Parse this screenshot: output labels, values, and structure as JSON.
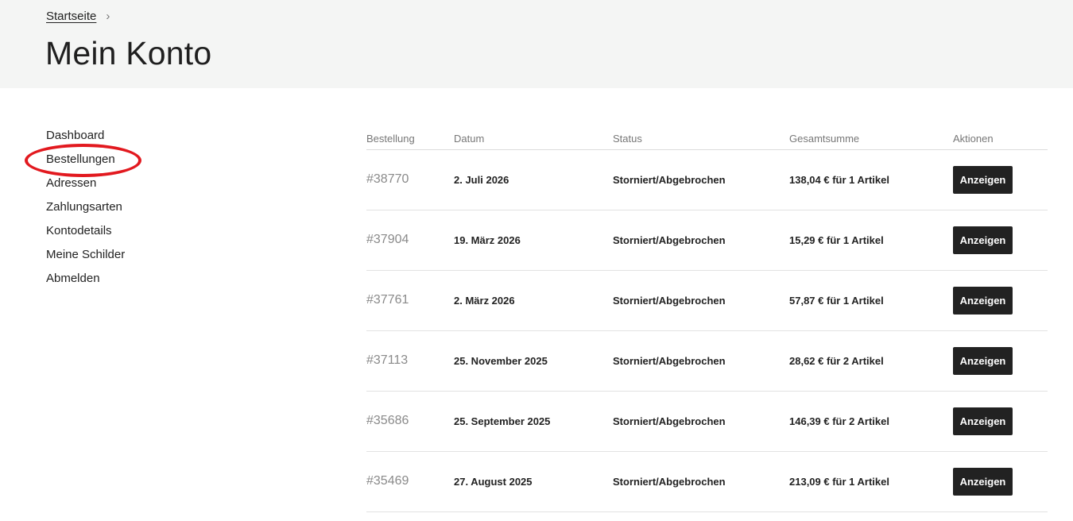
{
  "breadcrumb": {
    "home": "Startseite",
    "separator": "›"
  },
  "page_title": "Mein Konto",
  "account_nav": [
    {
      "label": "Dashboard"
    },
    {
      "label": "Bestellungen"
    },
    {
      "label": "Adressen"
    },
    {
      "label": "Zahlungsarten"
    },
    {
      "label": "Kontodetails"
    },
    {
      "label": "Meine Schilder"
    },
    {
      "label": "Abmelden"
    }
  ],
  "highlight_color": "#e2191f",
  "orders": {
    "headers": [
      "Bestellung",
      "Datum",
      "Status",
      "Gesamtsumme",
      "Aktionen"
    ],
    "rows": [
      {
        "number": "#38770",
        "date": "2. Juli 2026",
        "status": "Storniert/Abgebrochen",
        "total": "138,04 € für 1 Artikel",
        "action": "Anzeigen"
      },
      {
        "number": "#37904",
        "date": "19. März 2026",
        "status": "Storniert/Abgebrochen",
        "total": "15,29 € für 1 Artikel",
        "action": "Anzeigen"
      },
      {
        "number": "#37761",
        "date": "2. März 2026",
        "status": "Storniert/Abgebrochen",
        "total": "57,87 € für 1 Artikel",
        "action": "Anzeigen"
      },
      {
        "number": "#37113",
        "date": "25. November 2025",
        "status": "Storniert/Abgebrochen",
        "total": "28,62 € für 2 Artikel",
        "action": "Anzeigen"
      },
      {
        "number": "#35686",
        "date": "25. September 2025",
        "status": "Storniert/Abgebrochen",
        "total": "146,39 € für 2 Artikel",
        "action": "Anzeigen"
      },
      {
        "number": "#35469",
        "date": "27. August 2025",
        "status": "Storniert/Abgebrochen",
        "total": "213,09 € für 1 Artikel",
        "action": "Anzeigen"
      }
    ]
  }
}
